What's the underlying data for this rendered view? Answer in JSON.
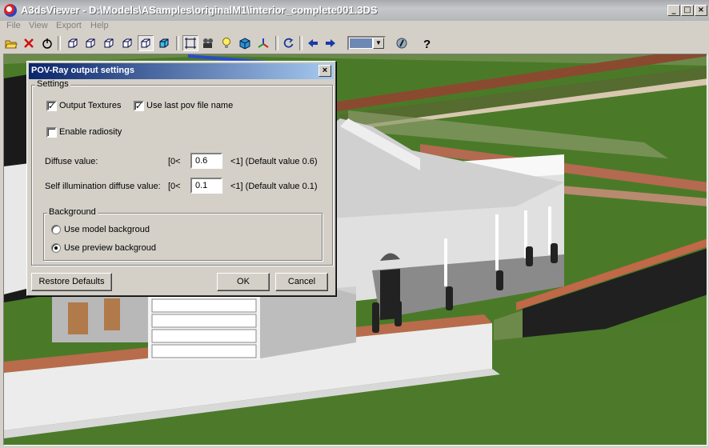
{
  "window": {
    "title": "A3dsViewer - D:\\Models\\ASamples\\originalM1\\interior_complete001.3DS",
    "controls": {
      "minimize": "_",
      "maximize": "□",
      "close": "×"
    }
  },
  "menu": [
    "File",
    "View",
    "Export",
    "Help"
  ],
  "toolbar": {
    "icons": [
      "open-folder-icon",
      "close-x-icon",
      "power-icon",
      "cube-view-1-icon",
      "cube-view-2-icon",
      "cube-view-3-icon",
      "cube-view-4-icon",
      "cube-view-5-icon",
      "cube-view-6-icon",
      "wireframe-box-icon",
      "film-camera-icon",
      "bulb-icon",
      "solid-cube-icon",
      "axis-icon",
      "refresh-icon",
      "arrow-left-icon",
      "arrow-right-icon",
      "settings-icon",
      "help-question-icon"
    ]
  },
  "dialog": {
    "title": "POV-Ray output settings",
    "close": "×",
    "settings_group": "Settings",
    "output_textures": {
      "label": "Output Textures",
      "checked": true
    },
    "use_last_pov": {
      "label": "Use last pov file name",
      "checked": true
    },
    "enable_radiosity": {
      "label": "Enable radiosity",
      "checked": false
    },
    "diffuse": {
      "label": "Diffuse value:",
      "prefix": "[0<",
      "value": "0.6",
      "suffix": "<1] (Default value 0.6)"
    },
    "self_illum": {
      "label": "Self illumination diffuse value:",
      "prefix": "[0<",
      "value": "0.1",
      "suffix": "<1] (Default value 0.1)"
    },
    "background_group": "Background",
    "bg_model": {
      "label": "Use model backgroud",
      "selected": false
    },
    "bg_preview": {
      "label": "Use preview backgroud",
      "selected": true
    },
    "buttons": {
      "restore": "Restore Defaults",
      "ok": "OK",
      "cancel": "Cancel"
    }
  },
  "colors": {
    "grass": "#4c7a2a",
    "wall_top": "#b05a3a",
    "house": "#e8e8e8",
    "title_active": "#0a246a"
  }
}
